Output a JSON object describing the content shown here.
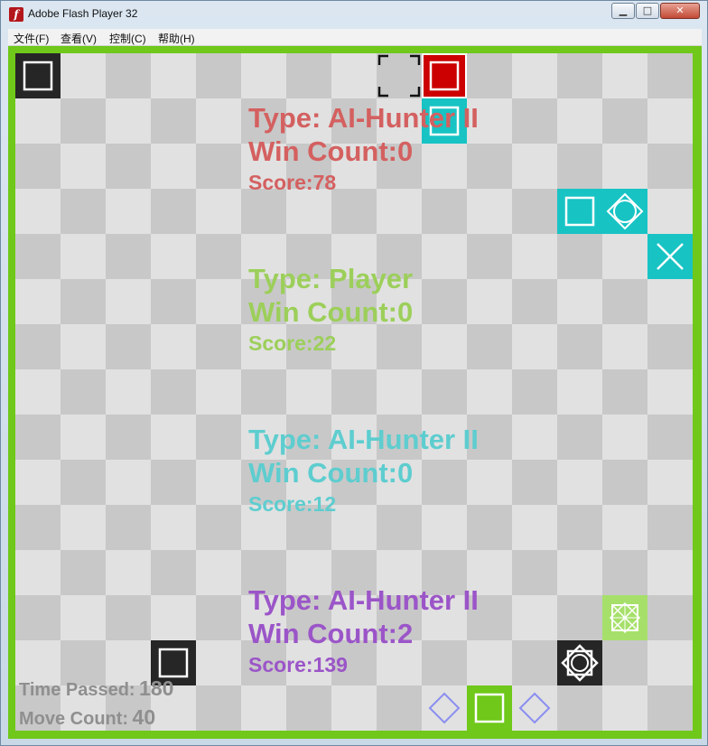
{
  "window": {
    "title": "Adobe Flash Player 32",
    "icon": "flash-icon",
    "buttons": {
      "minimize": "▁",
      "maximize": "□",
      "close": "✕"
    }
  },
  "menu": [
    {
      "label": "文件(F)"
    },
    {
      "label": "查看(V)"
    },
    {
      "label": "控制(C)"
    },
    {
      "label": "帮助(H)"
    }
  ],
  "colors": {
    "border": "#6fc81a",
    "checker_light": "#e1e1e1",
    "checker_dark": "#c8c8c8",
    "red": "#cc0000",
    "cyan": "#18c3c4",
    "green": "#6fc81a",
    "light_green": "#a6e06a",
    "dark": "#262626",
    "purple_outline": "#8a8ef0"
  },
  "players": [
    {
      "type_label": "Type:",
      "type": "AI-Hunter II",
      "win_label": "Win Count:",
      "win": "0",
      "score_label": "Score:",
      "score": "78",
      "color": "#d46060"
    },
    {
      "type_label": "Type:",
      "type": "Player",
      "win_label": "Win Count:",
      "win": "0",
      "score_label": "Score:",
      "score": "22",
      "color": "#9ccf5a"
    },
    {
      "type_label": "Type:",
      "type": "AI-Hunter II",
      "win_label": "Win Count:",
      "win": "0",
      "score_label": "Score:",
      "score": "12",
      "color": "#5ecdcf"
    },
    {
      "type_label": "Type:",
      "type": "AI-Hunter II",
      "win_label": "Win Count:",
      "win": "2",
      "score_label": "Score:",
      "score": "139",
      "color": "#9b55c8"
    }
  ],
  "stats": {
    "time_label": "Time Passed:",
    "time_value": "180",
    "moves_label": "Move Count:",
    "moves_value": "40"
  },
  "pieces": [
    {
      "name": "dark-square-piece",
      "col": 0,
      "row": 0,
      "color": "#262626",
      "icon": "square"
    },
    {
      "name": "selection-bracket-marker",
      "col": 8,
      "row": 0,
      "color": "none",
      "icon": "brackets"
    },
    {
      "name": "red-square-piece",
      "col": 9,
      "row": 0,
      "color": "#cc0000",
      "icon": "square"
    },
    {
      "name": "cyan-square-piece",
      "col": 9,
      "row": 1,
      "color": "#18c3c4",
      "icon": "square"
    },
    {
      "name": "cyan-square-piece",
      "col": 12,
      "row": 3,
      "color": "#18c3c4",
      "icon": "square"
    },
    {
      "name": "cyan-star-piece",
      "col": 13,
      "row": 3,
      "color": "#18c3c4",
      "icon": "diamond-circle"
    },
    {
      "name": "cyan-cross-piece",
      "col": 14,
      "row": 4,
      "color": "#18c3c4",
      "icon": "cross"
    },
    {
      "name": "light-green-star-piece",
      "col": 13,
      "row": 12,
      "color": "#a6e06a",
      "icon": "star-box"
    },
    {
      "name": "dark-square-piece",
      "col": 3,
      "row": 13,
      "color": "#262626",
      "icon": "square"
    },
    {
      "name": "dark-star-piece",
      "col": 12,
      "row": 13,
      "color": "#262626",
      "icon": "octagram"
    },
    {
      "name": "purple-diamond-piece",
      "col": 9,
      "row": 14,
      "color": "none",
      "icon": "diamond-outline"
    },
    {
      "name": "green-square-piece",
      "col": 10,
      "row": 14,
      "color": "#6fc81a",
      "icon": "square"
    },
    {
      "name": "purple-diamond-piece",
      "col": 11,
      "row": 14,
      "color": "none",
      "icon": "diamond-outline"
    }
  ]
}
